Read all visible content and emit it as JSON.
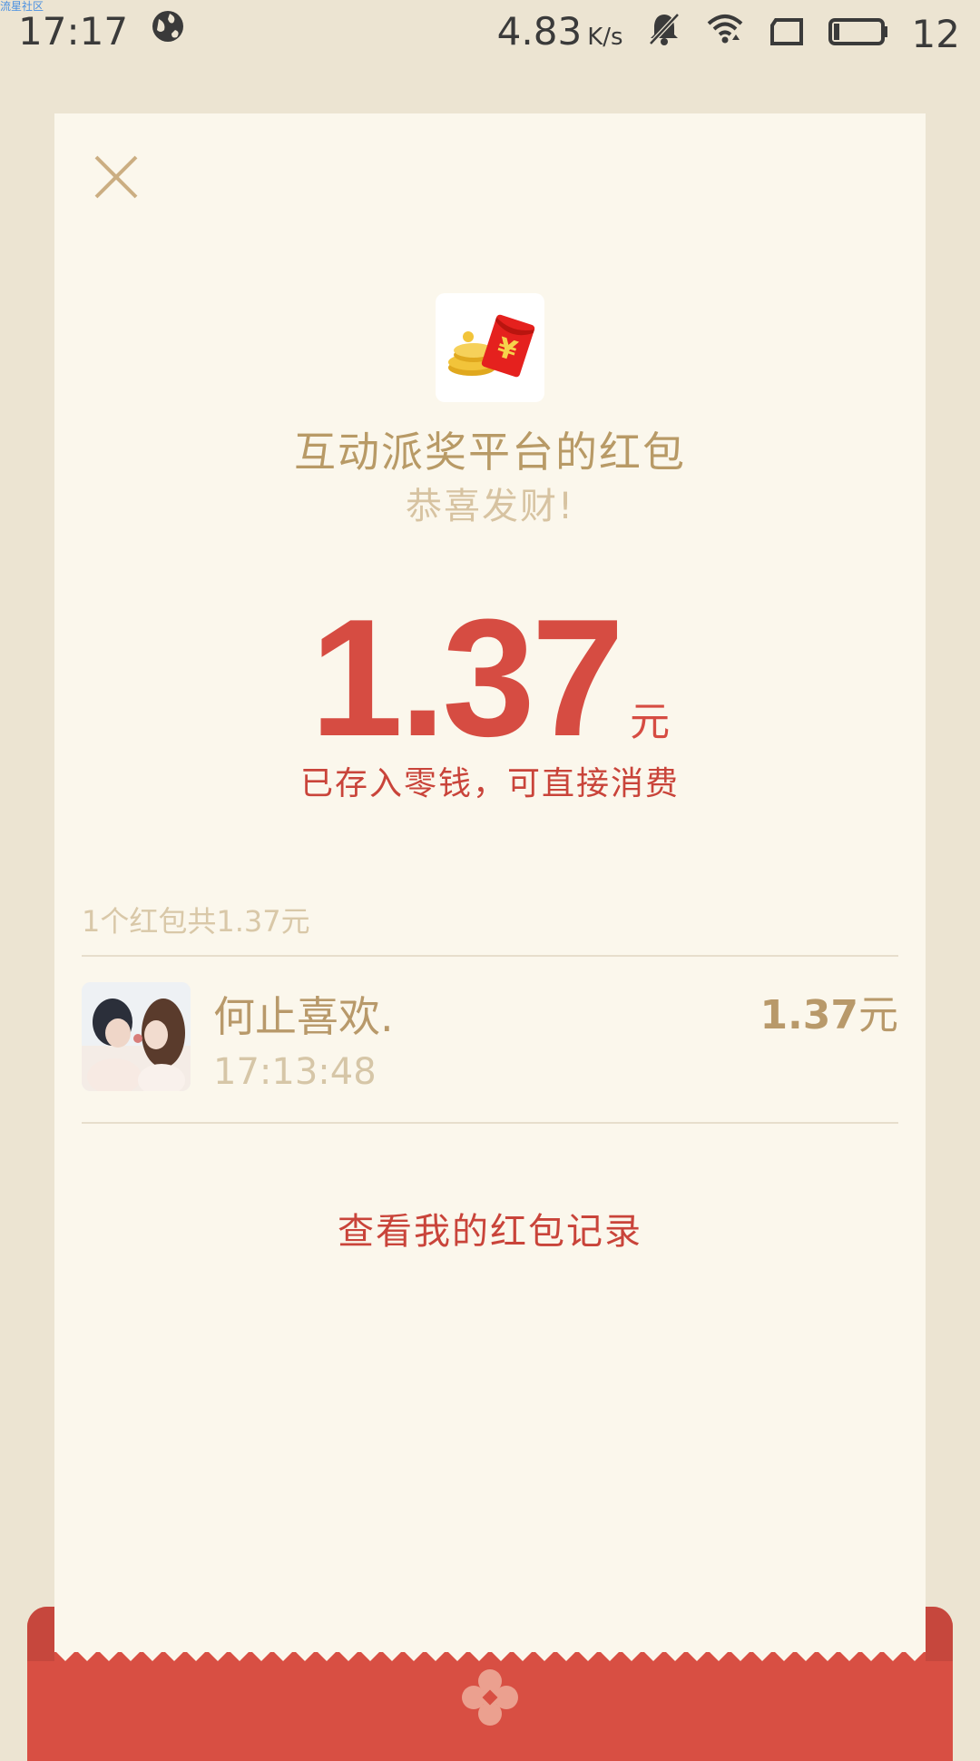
{
  "status_bar": {
    "time": "17:17",
    "speed_value": "4.83",
    "speed_unit": "K/s",
    "battery": "12",
    "watermark": "流星社区"
  },
  "envelope": {
    "sender": "互动派奖平台的红包",
    "greeting": "恭喜发财!",
    "amount": "1.37",
    "currency": "元",
    "deposit_note": "已存入零钱，可直接消费"
  },
  "summary": {
    "text": "1个红包共1.37元"
  },
  "records": [
    {
      "name": "何止喜欢.",
      "time": "17:13:48",
      "amount": "1.37",
      "currency": "元"
    }
  ],
  "actions": {
    "history_link": "查看我的红包记录"
  },
  "colors": {
    "background": "#ECE4D2",
    "card": "#FBF7EC",
    "accent_red": "#D64C42",
    "gold_text": "#B89A66",
    "envelope_red": "#D84F43"
  },
  "icons": {
    "close": "close-icon",
    "logo": "red-packet-coins-icon",
    "emblem": "flower-emblem-icon"
  }
}
